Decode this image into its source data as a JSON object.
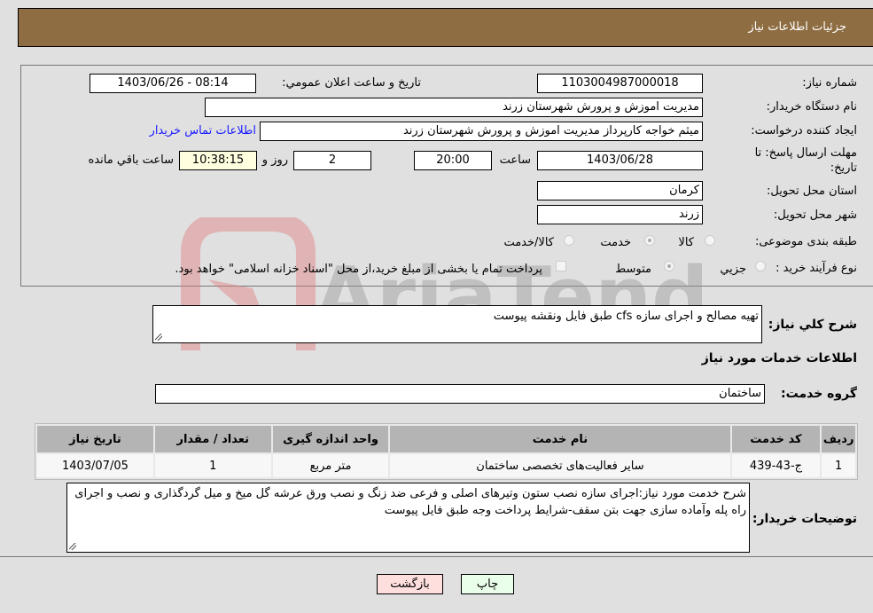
{
  "header": {
    "title": "جزئیات اطلاعات نیاز"
  },
  "fields": {
    "need_number": {
      "label": "شماره نياز:",
      "value": "1103004987000018"
    },
    "announce_datetime": {
      "label": "تاريخ و ساعت اعلان عمومي:",
      "value": "1403/06/26 - 08:14"
    },
    "buyer_org": {
      "label": "نام دستگاه خريدار:",
      "value": "مديريت اموزش و پرورش شهرستان زرند"
    },
    "requester": {
      "label": "ايجاد کننده درخواست:",
      "value": "ميثم خواجه کارپرداز مديريت اموزش و پرورش شهرستان زرند"
    },
    "buyer_contact_link": "اطلاعات تماس خريدار",
    "deadline": {
      "label_line1": "مهلت ارسال پاسخ: تا",
      "label_line2": "تاريخ:",
      "date": "1403/06/28",
      "time_label": "ساعت",
      "time": "20:00",
      "days": "2",
      "days_label": "روز و",
      "remaining": "10:38:15",
      "remaining_label": "ساعت باقي مانده"
    },
    "province": {
      "label": "استان محل تحويل:",
      "value": "کرمان"
    },
    "city": {
      "label": "شهر محل تحويل:",
      "value": "زرند"
    },
    "category": {
      "label": "طبقه بندی موضوعی:",
      "options": [
        {
          "label": "کالا",
          "checked": false
        },
        {
          "label": "خدمت",
          "checked": true
        },
        {
          "label": "کالا/خدمت",
          "checked": false
        }
      ]
    },
    "purchase_process": {
      "label": "نوع فرآيند خريد :",
      "options": [
        {
          "label": "جزيي",
          "checked": false
        },
        {
          "label": "متوسط",
          "checked": true
        }
      ],
      "payment_note": "پرداخت تمام يا بخشی از مبلغ خريد،از محل \"اسناد خزانه اسلامی\" خواهد بود."
    }
  },
  "summary": {
    "label": "شرح کلي نياز:",
    "value": "تهيه مصالح و اجرای سازه cfs طبق فايل ونقشه پيوست"
  },
  "services_section_title": "اطلاعات خدمات مورد نياز",
  "service_group": {
    "label": "گروه خدمت:",
    "value": "ساختمان"
  },
  "table": {
    "headers": [
      "رديف",
      "کد خدمت",
      "نام خدمت",
      "واحد اندازه گيری",
      "تعداد / مقدار",
      "تاريخ نياز"
    ],
    "rows": [
      [
        "1",
        "ج-43-439",
        "ساير فعاليت‌های تخصصی ساختمان",
        "متر مربع",
        "1",
        "1403/07/05"
      ]
    ]
  },
  "buyer_notes": {
    "label": "توضيحات خريدار:",
    "value": "شرح خدمت مورد نياز:اجرای سازه نصب ستون وتيرهای اصلی و فرعی ضد زنگ و نصب ورق عرشه گل ميخ و ميل گردگذاری و نصب و اجرای راه پله وآماده سازی جهت بتن سقف-شرايط پرداخت وجه طبق فايل پيوست"
  },
  "buttons": {
    "print": "چاپ",
    "back": "بازگشت"
  },
  "colors": {
    "header_bg": "#8e6d42",
    "print_bg": "#eaffea",
    "back_bg": "#ffdede",
    "link": "#1a1aff"
  }
}
